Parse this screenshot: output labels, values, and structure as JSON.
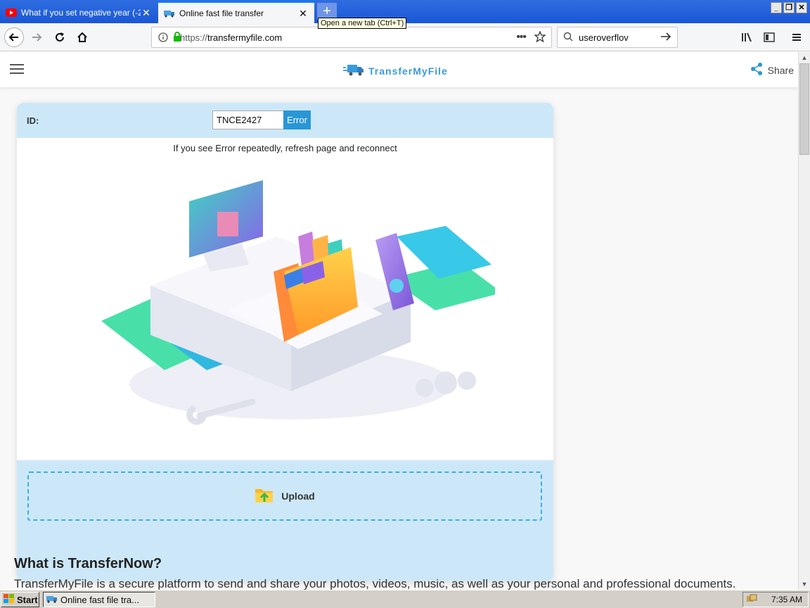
{
  "browser": {
    "tabs": [
      {
        "title": "What if you set negative year (-2",
        "favicon": "youtube-icon"
      },
      {
        "title": "Online fast file transfer",
        "favicon": "truck-icon"
      }
    ],
    "new_tab_tooltip": "Open a new tab (Ctrl+T)",
    "url_prefix": "https://",
    "url_domain": "transfermyfile.com",
    "search_value": "useroverflov"
  },
  "site": {
    "logo_text": "TransferMyFile",
    "share_label": "Share"
  },
  "connect": {
    "id_label": "ID:",
    "id_value": "TNCE2427",
    "status_label": "Error",
    "notice": "If you see Error repeatedly, refresh page and reconnect",
    "upload_label": "Upload"
  },
  "content": {
    "heading": "What is TransferNow?",
    "description": "TransferMyFile is a secure platform to send and share your photos, videos, music, as well as your personal and professional documents."
  },
  "taskbar": {
    "start_label": "Start",
    "task_label": "Online fast file tra...",
    "clock": "7:35 AM"
  },
  "colors": {
    "accent": "#2996d6",
    "panel": "#cce8f8",
    "titlebar": "#1a57d6"
  }
}
